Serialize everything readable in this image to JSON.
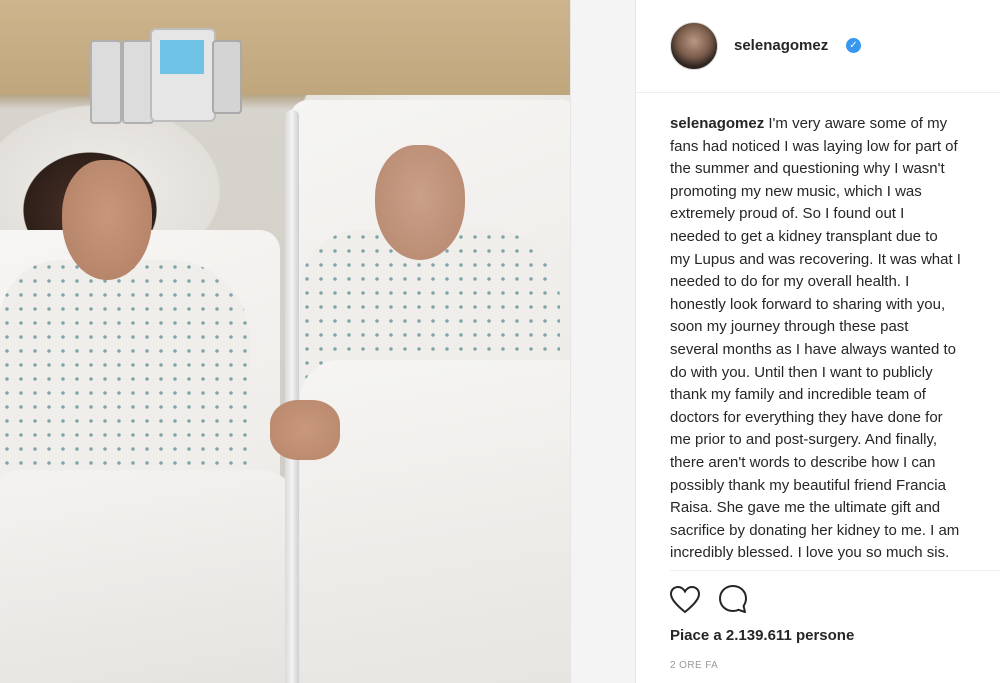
{
  "photo": {
    "description_icon": "photo"
  },
  "header": {
    "username": "selenagomez",
    "verified_mark": "✓"
  },
  "caption": {
    "username": "selenagomez",
    "lines": [
      " I'm very aware some of my",
      "fans had noticed I was laying low for part of",
      "the summer and questioning why I wasn't",
      "promoting my new music, which I was",
      "extremely proud of. So I found out I",
      "needed to get a kidney transplant due to",
      "my Lupus and was recovering. It was what I",
      "needed to do for my overall health. I",
      "honestly look forward to sharing with you,",
      "soon my journey through these past",
      "several months as I have always wanted to",
      "do with you. Until then I want to publicly",
      "thank my family and incredible team of",
      "doctors for everything they have done for",
      "me prior to and post-surgery. And finally,",
      "there aren't words to describe how I can",
      "possibly thank my beautiful friend Francia",
      "Raisa. She gave me the ultimate gift and",
      "sacrifice by donating her kidney to me. I am",
      "incredibly blessed. I love you so much sis."
    ]
  },
  "actions": {
    "like_icon": "heart-outline-icon",
    "comment_icon": "comment-bubble-icon"
  },
  "likes": {
    "prefix": "Piace a ",
    "count": "2.139.611",
    "suffix": " persone"
  },
  "timestamp": "2 ORE FA",
  "colors": {
    "verified": "#3897f0",
    "text": "#262626",
    "muted": "#999999"
  }
}
